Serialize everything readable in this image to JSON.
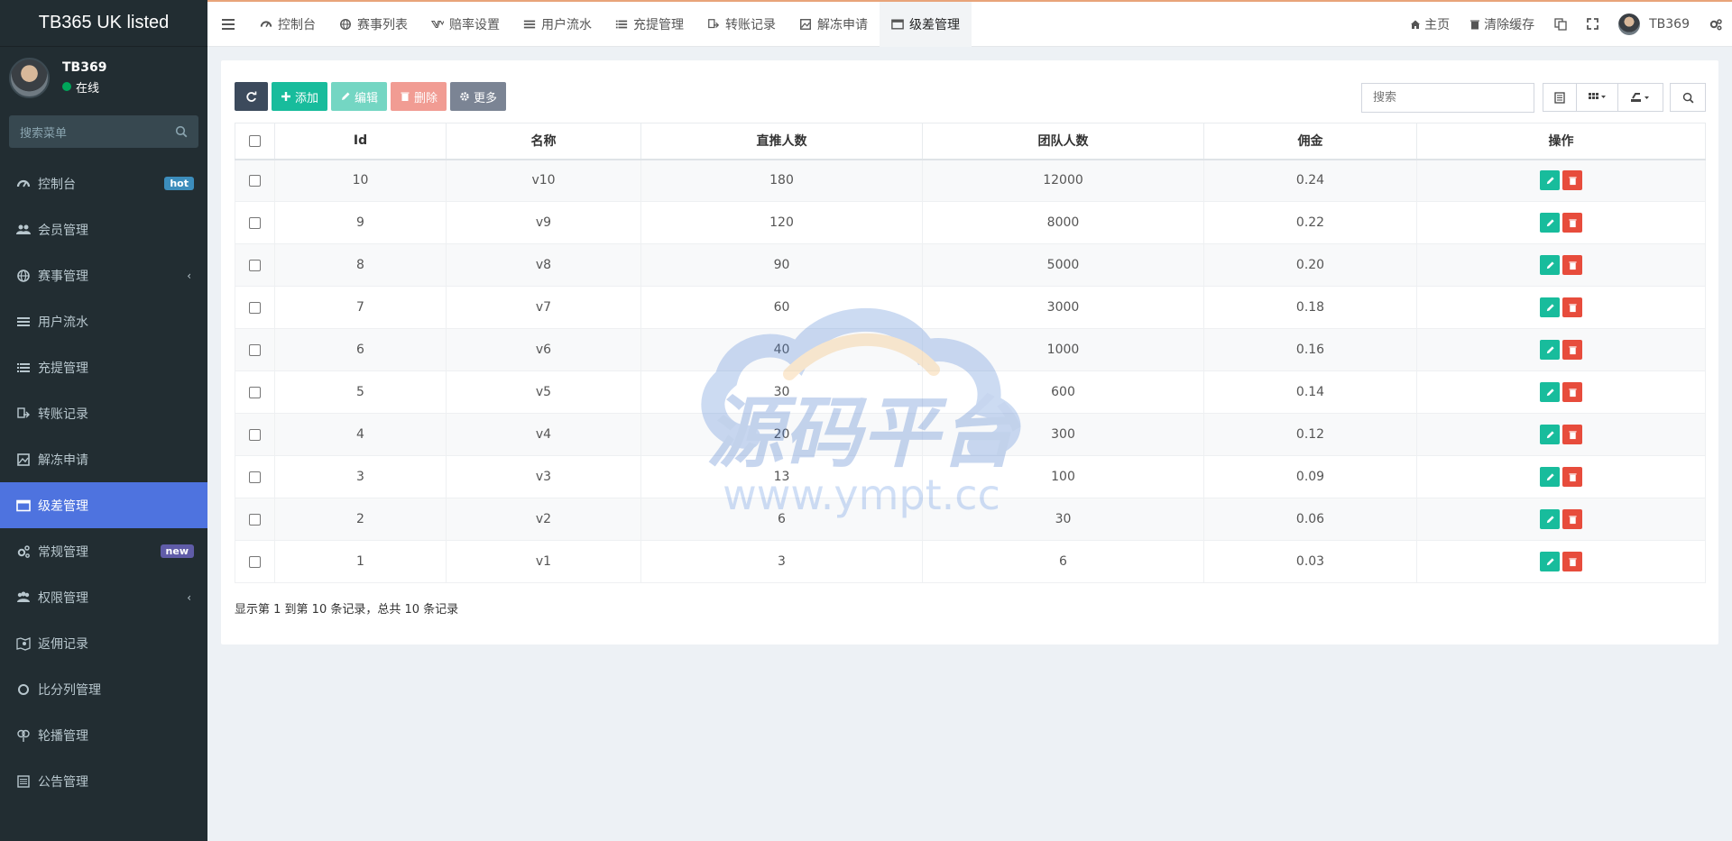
{
  "brand": "TB365 UK listed",
  "user": {
    "name": "TB369",
    "status": "在线"
  },
  "menu_search": {
    "placeholder": "搜索菜单"
  },
  "sidebar": {
    "items": [
      {
        "label": "控制台",
        "icon": "dashboard-icon",
        "badge": "hot"
      },
      {
        "label": "会员管理",
        "icon": "users-icon"
      },
      {
        "label": "赛事管理",
        "icon": "globe-icon",
        "chevron": "‹"
      },
      {
        "label": "用户流水",
        "icon": "list-icon"
      },
      {
        "label": "充提管理",
        "icon": "list-alt-icon"
      },
      {
        "label": "转账记录",
        "icon": "transfer-icon"
      },
      {
        "label": "解冻申请",
        "icon": "picture-icon"
      },
      {
        "label": "级差管理",
        "icon": "window-icon",
        "active": true
      },
      {
        "label": "常规管理",
        "icon": "cogs-icon",
        "badge": "new"
      },
      {
        "label": "权限管理",
        "icon": "group-icon",
        "chevron": "‹"
      },
      {
        "label": "返佣记录",
        "icon": "map-icon"
      },
      {
        "label": "比分列管理",
        "icon": "circle-icon"
      },
      {
        "label": "轮播管理",
        "icon": "carousel-icon"
      },
      {
        "label": "公告管理",
        "icon": "notice-icon"
      }
    ]
  },
  "topbar": {
    "tabs": [
      {
        "label": "控制台"
      },
      {
        "label": "赛事列表"
      },
      {
        "label": "赔率设置"
      },
      {
        "label": "用户流水"
      },
      {
        "label": "充提管理"
      },
      {
        "label": "转账记录"
      },
      {
        "label": "解冻申请"
      },
      {
        "label": "级差管理",
        "active": true
      }
    ],
    "right": {
      "home": "主页",
      "clear_cache": "清除缓存",
      "username": "TB369"
    }
  },
  "toolbar": {
    "add": "添加",
    "edit": "编辑",
    "delete": "删除",
    "more": "更多",
    "search_placeholder": "搜索"
  },
  "table": {
    "headers": [
      "Id",
      "名称",
      "直推人数",
      "团队人数",
      "佣金",
      "操作"
    ],
    "rows": [
      {
        "id": "10",
        "name": "v10",
        "direct": "180",
        "team": "12000",
        "commission": "0.24"
      },
      {
        "id": "9",
        "name": "v9",
        "direct": "120",
        "team": "8000",
        "commission": "0.22"
      },
      {
        "id": "8",
        "name": "v8",
        "direct": "90",
        "team": "5000",
        "commission": "0.20"
      },
      {
        "id": "7",
        "name": "v7",
        "direct": "60",
        "team": "3000",
        "commission": "0.18"
      },
      {
        "id": "6",
        "name": "v6",
        "direct": "40",
        "team": "1000",
        "commission": "0.16"
      },
      {
        "id": "5",
        "name": "v5",
        "direct": "30",
        "team": "600",
        "commission": "0.14"
      },
      {
        "id": "4",
        "name": "v4",
        "direct": "20",
        "team": "300",
        "commission": "0.12"
      },
      {
        "id": "3",
        "name": "v3",
        "direct": "13",
        "team": "100",
        "commission": "0.09"
      },
      {
        "id": "2",
        "name": "v2",
        "direct": "6",
        "team": "30",
        "commission": "0.06"
      },
      {
        "id": "1",
        "name": "v1",
        "direct": "3",
        "team": "6",
        "commission": "0.03"
      }
    ]
  },
  "pagination": {
    "info": "显示第 1 到第 10 条记录，总共 10 条记录"
  },
  "watermark": {
    "title": "源码平台",
    "url": "www.ympt.cc"
  },
  "colors": {
    "sidebar_bg": "#222d32",
    "active": "#4e73df",
    "success": "#18bc9c",
    "danger": "#e74c3c"
  }
}
